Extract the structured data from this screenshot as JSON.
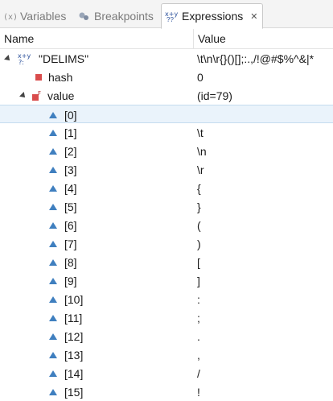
{
  "tabs": [
    {
      "label": "Variables",
      "icon": "variables-icon",
      "active": false
    },
    {
      "label": "Breakpoints",
      "icon": "breakpoints-icon",
      "active": false
    },
    {
      "label": "Expressions",
      "icon": "expressions-icon",
      "active": true,
      "close": "✕"
    }
  ],
  "table": {
    "columns": {
      "name": "Name",
      "value": "Value"
    },
    "rows": [
      {
        "name": "\"DELIMS\"",
        "value": "\\t\\n\\r{}()[];:.,/!@#$%^&|*",
        "icon": "expression-icon",
        "expanded": true
      },
      {
        "name": "hash",
        "value": "0",
        "icon": "field-icon"
      },
      {
        "name": "value",
        "value": "(id=79)",
        "icon": "final-field-icon",
        "expanded": true
      },
      {
        "name": "[0]",
        "value": "",
        "icon": "element-icon",
        "selected": true
      },
      {
        "name": "[1]",
        "value": "\\t",
        "icon": "element-icon"
      },
      {
        "name": "[2]",
        "value": "\\n",
        "icon": "element-icon"
      },
      {
        "name": "[3]",
        "value": "\\r",
        "icon": "element-icon"
      },
      {
        "name": "[4]",
        "value": "{",
        "icon": "element-icon"
      },
      {
        "name": "[5]",
        "value": "}",
        "icon": "element-icon"
      },
      {
        "name": "[6]",
        "value": "(",
        "icon": "element-icon"
      },
      {
        "name": "[7]",
        "value": ")",
        "icon": "element-icon"
      },
      {
        "name": "[8]",
        "value": "[",
        "icon": "element-icon"
      },
      {
        "name": "[9]",
        "value": "]",
        "icon": "element-icon"
      },
      {
        "name": "[10]",
        "value": ":",
        "icon": "element-icon"
      },
      {
        "name": "[11]",
        "value": ";",
        "icon": "element-icon"
      },
      {
        "name": "[12]",
        "value": ".",
        "icon": "element-icon"
      },
      {
        "name": "[13]",
        "value": ",",
        "icon": "element-icon"
      },
      {
        "name": "[14]",
        "value": "/",
        "icon": "element-icon"
      },
      {
        "name": "[15]",
        "value": "!",
        "icon": "element-icon"
      }
    ]
  },
  "colors": {
    "selected_row": "#eaf3fb",
    "element_icon": "#3f7fbf",
    "field_icon": "#d94c4c"
  }
}
